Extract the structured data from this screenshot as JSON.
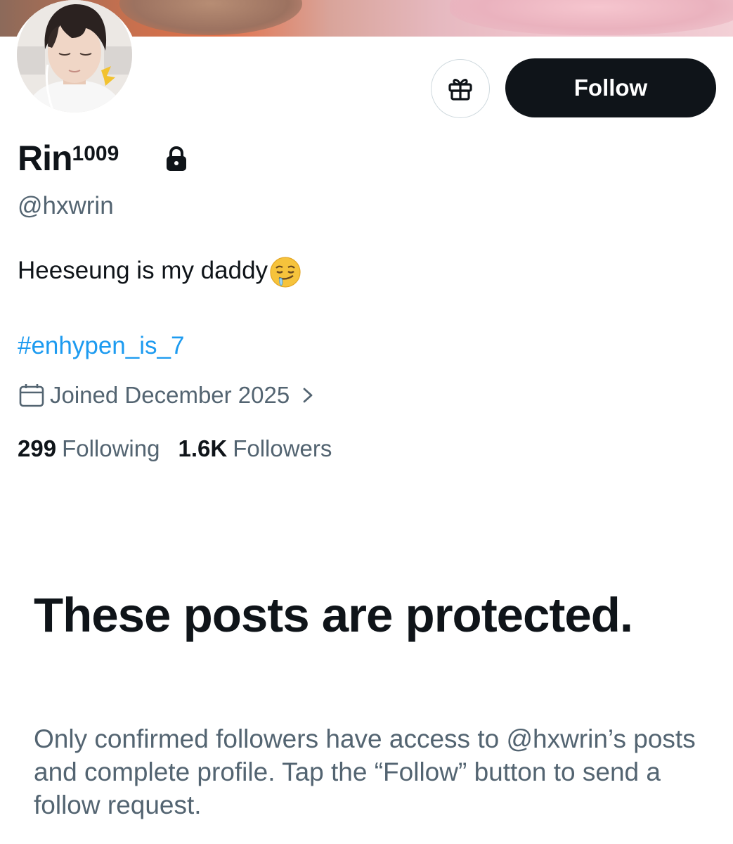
{
  "profile": {
    "display_name": "Rin",
    "display_name_superscript": "1009",
    "handle": "@hxwrin",
    "bio": "Heeseung is my daddy",
    "bio_emoji": "drooling-face-emoji",
    "hashtag": "#enhypen_is_7",
    "joined": "Joined December 2025",
    "following_count": "299",
    "following_label": "Following",
    "followers_count": "1.6K",
    "followers_label": "Followers"
  },
  "actions": {
    "gift_icon": "gift-icon",
    "follow_label": "Follow"
  },
  "protected": {
    "title": "These posts are protected.",
    "description": "Only confirmed followers have access to @hxwrin’s posts and complete profile. Tap the “Follow” button to send a follow request."
  },
  "colors": {
    "primary_text": "#0f1419",
    "secondary_text": "#536471",
    "link": "#1d9bf0",
    "button_dark": "#0f1419",
    "border": "#cfd9de"
  }
}
